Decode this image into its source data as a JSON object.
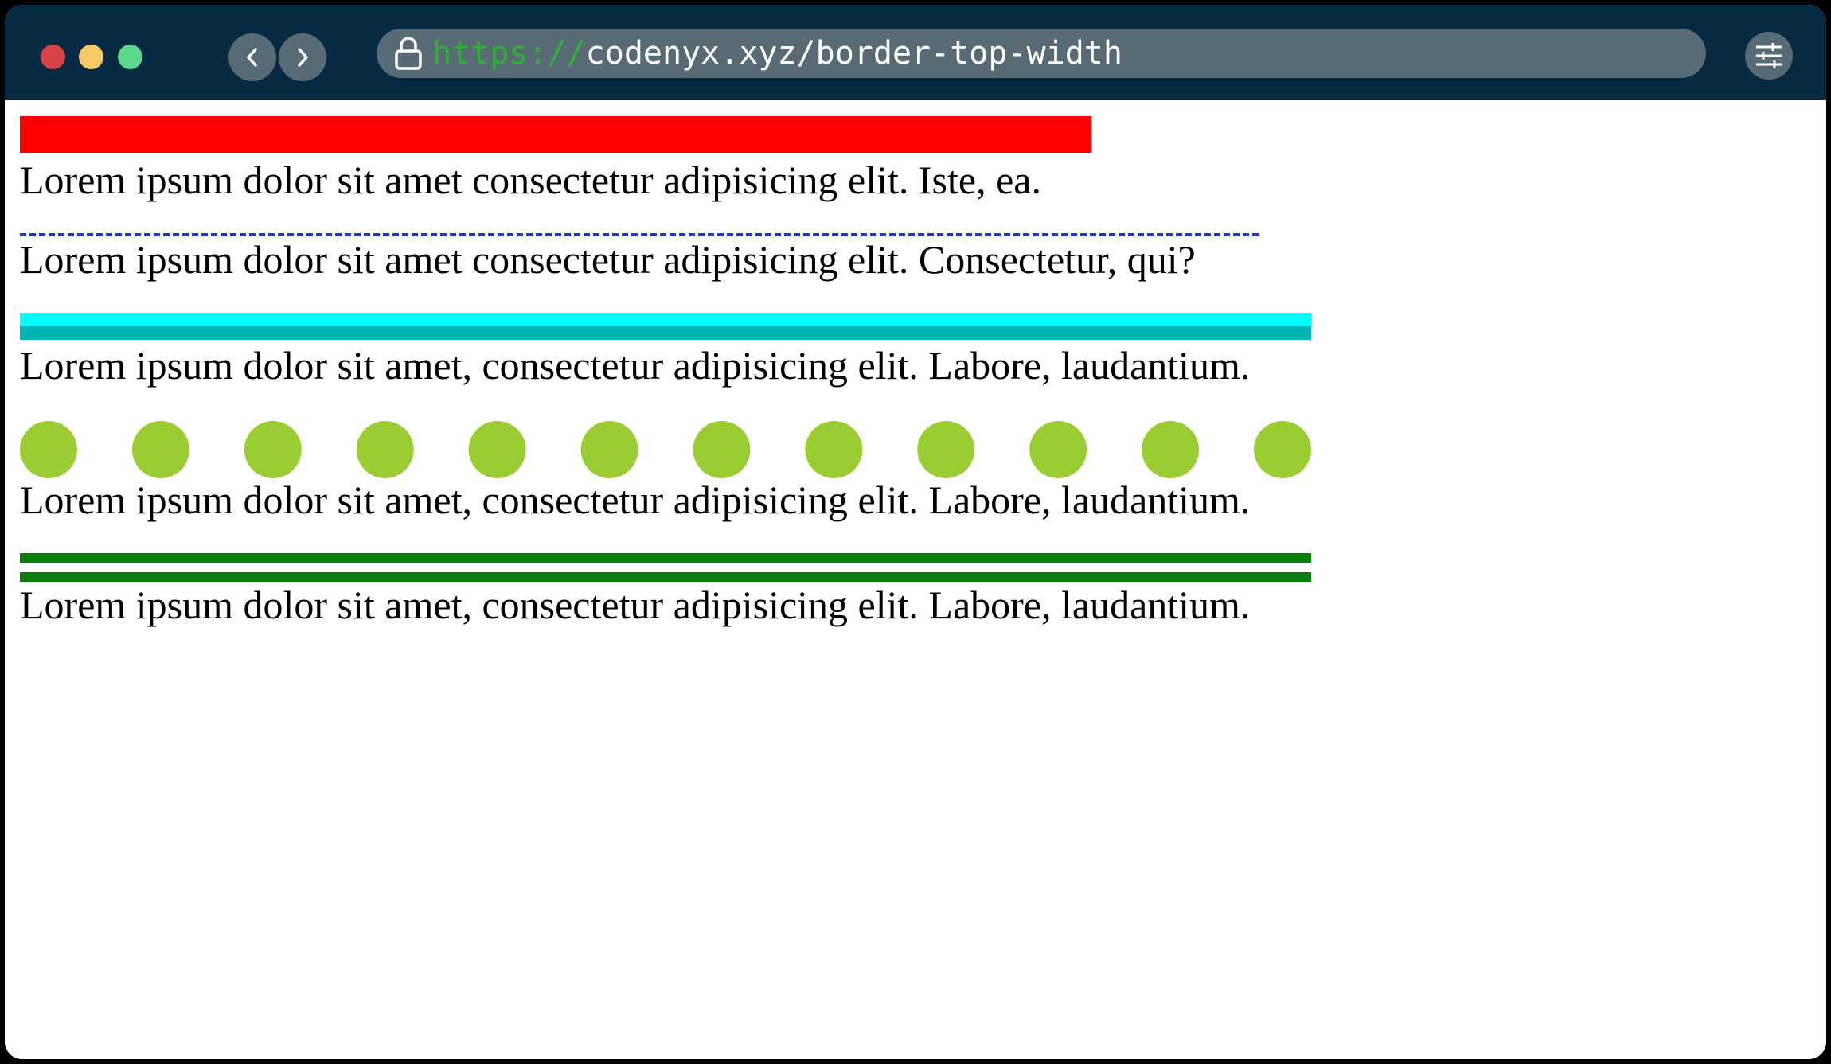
{
  "browser": {
    "url_scheme": "https://",
    "url_rest": "codenyx.xyz/border-top-width",
    "colors": {
      "titlebar": "#052a42",
      "control": "#586a74",
      "close": "#d94246",
      "minimize": "#f6c967",
      "maximize": "#5bd88c",
      "scheme": "#2fae3a"
    },
    "icons": [
      "lock-icon",
      "chevron-left-icon",
      "chevron-right-icon",
      "settings-sliders-icon"
    ]
  },
  "content": {
    "paragraphs": [
      "Lorem ipsum dolor sit amet consectetur adipisicing elit. Iste, ea.",
      "Lorem ipsum dolor sit amet consectetur adipisicing elit. Consectetur, qui?",
      "Lorem ipsum dolor sit amet, consectetur adipisicing elit. Labore, laudantium.",
      "Lorem ipsum dolor sit amet, consectetur adipisicing elit. Labore, laudantium.",
      "Lorem ipsum dolor sit amet, consectetur adipisicing elit. Labore, laudantium."
    ],
    "borders": [
      {
        "style": "solid",
        "color": "#ff0000"
      },
      {
        "style": "dashed",
        "color": "#1f35d8"
      },
      {
        "style": "ridge",
        "color": "#00ffff",
        "shade": "#00b3b3"
      },
      {
        "style": "dotted",
        "color": "#9acd32",
        "dot_count": 12
      },
      {
        "style": "double",
        "color": "#0a7d0a"
      }
    ]
  }
}
